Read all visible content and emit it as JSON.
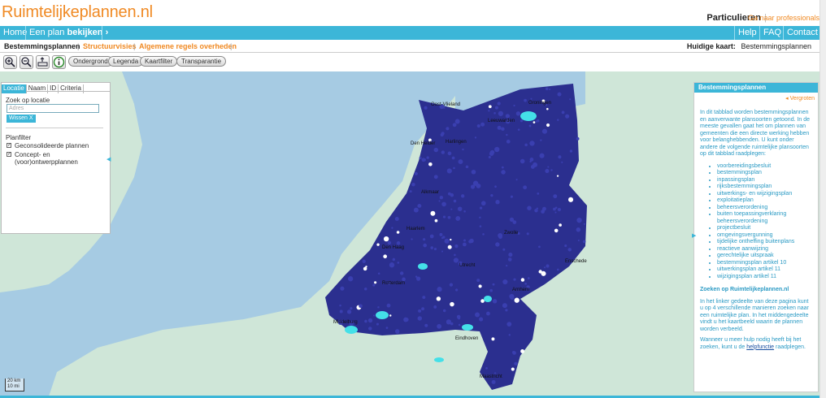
{
  "header": {
    "logo": "Ruimtelijkeplannen.nl",
    "audience": "Particulieren",
    "separator": "|",
    "pro_link": "Ga naar professionals"
  },
  "nav": {
    "home": "Home",
    "view_prefix": "Een plan",
    "view_bold": "bekijken",
    "view_arrow": "›",
    "help": "Help",
    "faq": "FAQ",
    "contact": "Contact"
  },
  "subnav": {
    "tabs": [
      "Bestemmingsplannen",
      "Structuurvisies",
      "Algemene regels overheden"
    ],
    "current_map_label": "Huidige kaart:",
    "current_map_value": "Bestemmingsplannen"
  },
  "toolbar": {
    "zoom_in_icon": "zoom-in-icon",
    "zoom_out_icon": "zoom-out-icon",
    "extent_icon": "full-extent-icon",
    "info_icon": "info-icon",
    "buttons": [
      "Ondergrond",
      "Legenda",
      "Kaartfilter",
      "Transparantie"
    ]
  },
  "left_panel": {
    "tabs": [
      "Locatie",
      "Naam",
      "ID",
      "Criteria"
    ],
    "search_label": "Zoek op locatie",
    "search_placeholder": "Adres",
    "clear_button": "Wissen  X",
    "planfilter_label": "Planfilter",
    "filters": [
      {
        "label": "Geconsolideerde plannen",
        "checked": true
      },
      {
        "label": "Concept- en (voor)ontwerpplannen",
        "checked": true
      }
    ]
  },
  "map": {
    "scale_top": "20 km",
    "scale_bottom": "10 mi",
    "sea_color": "#a6cbe3",
    "land_color": "#cfe6d8",
    "plan_color": "#2b2f8f",
    "plan_highlight_color": "#44e0e8",
    "labels": [
      "Oost-Vlieland",
      "Harlingen",
      "Den Helder",
      "Alkmaar",
      "Haarlem",
      "Den Haag",
      "Rotterdam",
      "Utrecht",
      "Zwolle",
      "Groningen",
      "Leeuwarden",
      "Arnhem",
      "Eindhoven",
      "Maastricht",
      "Middelburg",
      "Enschede"
    ]
  },
  "right_panel": {
    "title": "Bestemmingsplannen",
    "enlarge": "Vergroten",
    "intro": "In dit tabblad worden bestemmingsplannen en aanverwante plansoorten getoond. In de meeste gevallen gaat het om plannen van gemeenten die een directe werking hebben voor belanghebbenden. U kunt onder andere de volgende ruimtelijke plansoorten op dit tabblad raadplegen:",
    "types": [
      "voorbereidingsbesluit",
      "bestemmingsplan",
      "inpassingsplan",
      "rijksbestemmingsplan",
      "uitwerkings- en wijzigingsplan",
      "exploitatieplan",
      "beheersverordening",
      "buiten toepassingverklaring beheersverordening",
      "projectbesluit",
      "omgevingsvergunning",
      "tijdelijke ontheffing buitenplans",
      "reactieve aanwijzing",
      "gerechtelijke uitspraak",
      "bestemmingsplan artikel 10",
      "uitwerkingsplan artikel 11",
      "wijzigingsplan artikel 11"
    ],
    "search_heading": "Zoeken op Ruimtelijkeplannen.nl",
    "search_text": "In het linker gedeelte van deze pagina kunt u op 4 verschillende manieren zoeken naar een ruimtelijke plan. In het middengedeelte vindt u het kaartbeeld waarin de plannen worden verbeeld.",
    "help_prefix": "Wanneer u meer hulp nodig heeft bij het zoeken, kunt u de",
    "help_link": "helpfunctie",
    "help_suffix": "raadplegen."
  }
}
